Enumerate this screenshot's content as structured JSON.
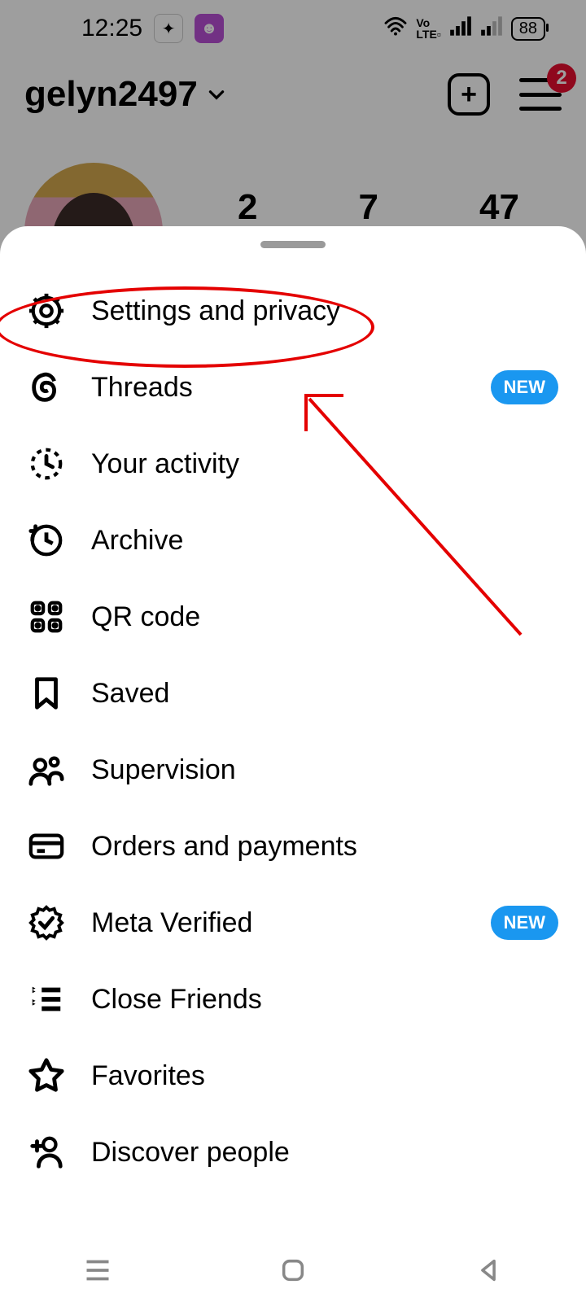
{
  "statusbar": {
    "time": "12:25",
    "battery": "88"
  },
  "profile": {
    "username": "gelyn2497",
    "stats": {
      "posts": "2",
      "followers": "7",
      "following": "47"
    },
    "menu_badge": "2"
  },
  "sheet": {
    "items": [
      {
        "icon": "gear",
        "label": "Settings and privacy",
        "badge": null
      },
      {
        "icon": "threads",
        "label": "Threads",
        "badge": "NEW"
      },
      {
        "icon": "activity",
        "label": "Your activity",
        "badge": null
      },
      {
        "icon": "archive",
        "label": "Archive",
        "badge": null
      },
      {
        "icon": "qr",
        "label": "QR code",
        "badge": null
      },
      {
        "icon": "bookmark",
        "label": "Saved",
        "badge": null
      },
      {
        "icon": "supervision",
        "label": "Supervision",
        "badge": null
      },
      {
        "icon": "card",
        "label": "Orders and payments",
        "badge": null
      },
      {
        "icon": "verified",
        "label": "Meta Verified",
        "badge": "NEW"
      },
      {
        "icon": "closefriends",
        "label": "Close Friends",
        "badge": null
      },
      {
        "icon": "star",
        "label": "Favorites",
        "badge": null
      },
      {
        "icon": "discover",
        "label": "Discover people",
        "badge": null
      }
    ]
  },
  "annotation": {
    "highlighted_item_index": 0
  }
}
